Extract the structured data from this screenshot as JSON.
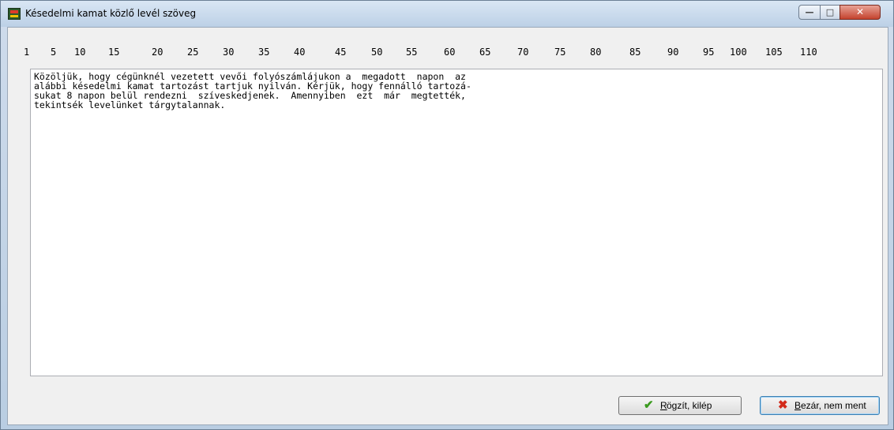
{
  "window": {
    "title": "Késedelmi kamat közlő levél szöveg",
    "minimize_glyph": "—",
    "maximize_glyph": "□",
    "close_glyph": "✕"
  },
  "ruler": {
    "marks": [
      "1",
      "5",
      "10",
      "15",
      "20",
      "25",
      "30",
      "35",
      "40",
      "45",
      "50",
      "55",
      "60",
      "65",
      "70",
      "75",
      "80",
      "85",
      "90",
      "95",
      "100",
      "105",
      "110"
    ]
  },
  "editor": {
    "text": "Közöljük, hogy cégünknél vezetett vevői folyószámlájukon a  megadott  napon  az\nalábbi késedelmi kamat tartozást tartjuk nyilván. Kérjük, hogy fennálló tartozá-\nsukat 8 napon belül rendezni  szíveskedjenek.  Amennyiben  ezt  már  megtették,\ntekintsék levelünket tárgytalannak."
  },
  "buttons": {
    "save": {
      "icon": "checkmark-icon",
      "icon_glyph": "✔",
      "mnemonic": "R",
      "label_rest": "ögzít, kilép",
      "color": "#3a9a1e"
    },
    "cancel": {
      "icon": "x-icon",
      "icon_glyph": "✖",
      "mnemonic": "B",
      "label_rest": "ezár, nem ment",
      "color": "#d22a1a"
    }
  }
}
